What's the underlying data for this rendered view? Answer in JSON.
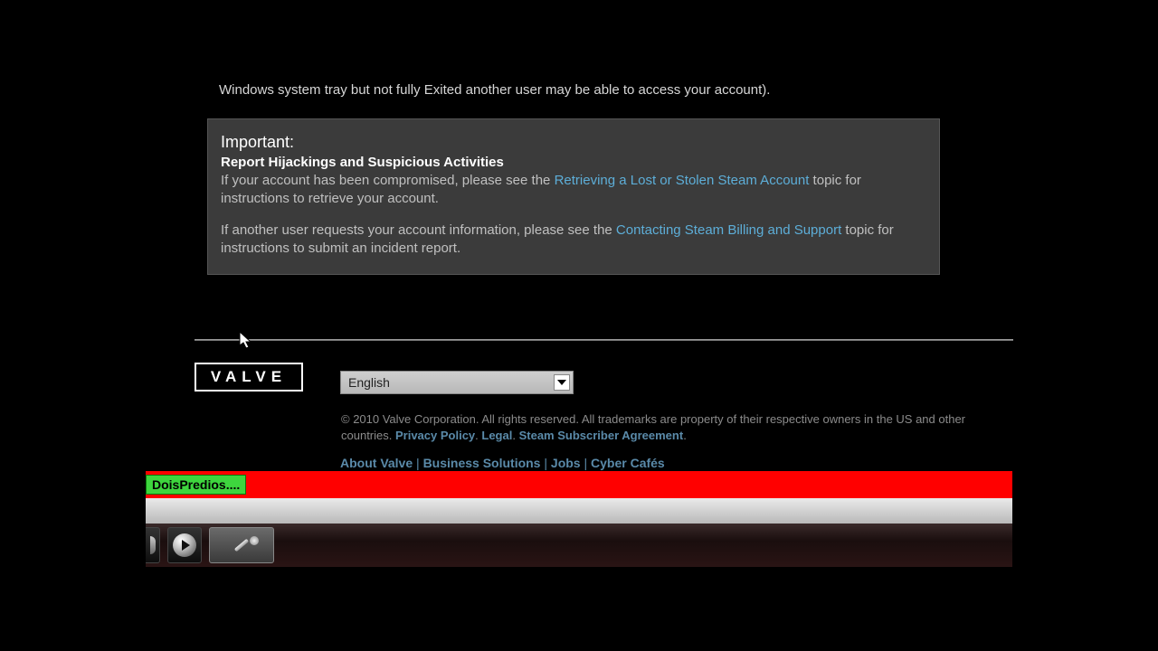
{
  "intro_text": "Windows system tray but not fully Exited another user may be able to access your account).",
  "important_box": {
    "title": "Important:",
    "heading": "Report Hijackings and Suspicious Activities",
    "p1_pre": "If your account has been compromised, please see the ",
    "p1_link": "Retrieving a Lost or Stolen Steam Account",
    "p1_post": " topic for instructions to retrieve your account.",
    "p2_pre": "If another user requests your account information, please see the ",
    "p2_link": "Contacting Steam Billing and Support",
    "p2_post": " topic for instructions to submit an incident report."
  },
  "logo_text": "VALVE",
  "language_selected": "English",
  "copyright": {
    "text_pre": "© 2010 Valve Corporation. All rights reserved. All trademarks are property of their respective owners in the US and other countries. ",
    "privacy": "Privacy Policy",
    "legal": "Legal",
    "agreement": "Steam Subscriber Agreement",
    "dot": ". "
  },
  "footer_links": {
    "about": "About Valve",
    "business": "Business Solutions",
    "jobs": "Jobs",
    "cyber": "Cyber Cafés"
  },
  "tab_label": "DoisPredios...."
}
